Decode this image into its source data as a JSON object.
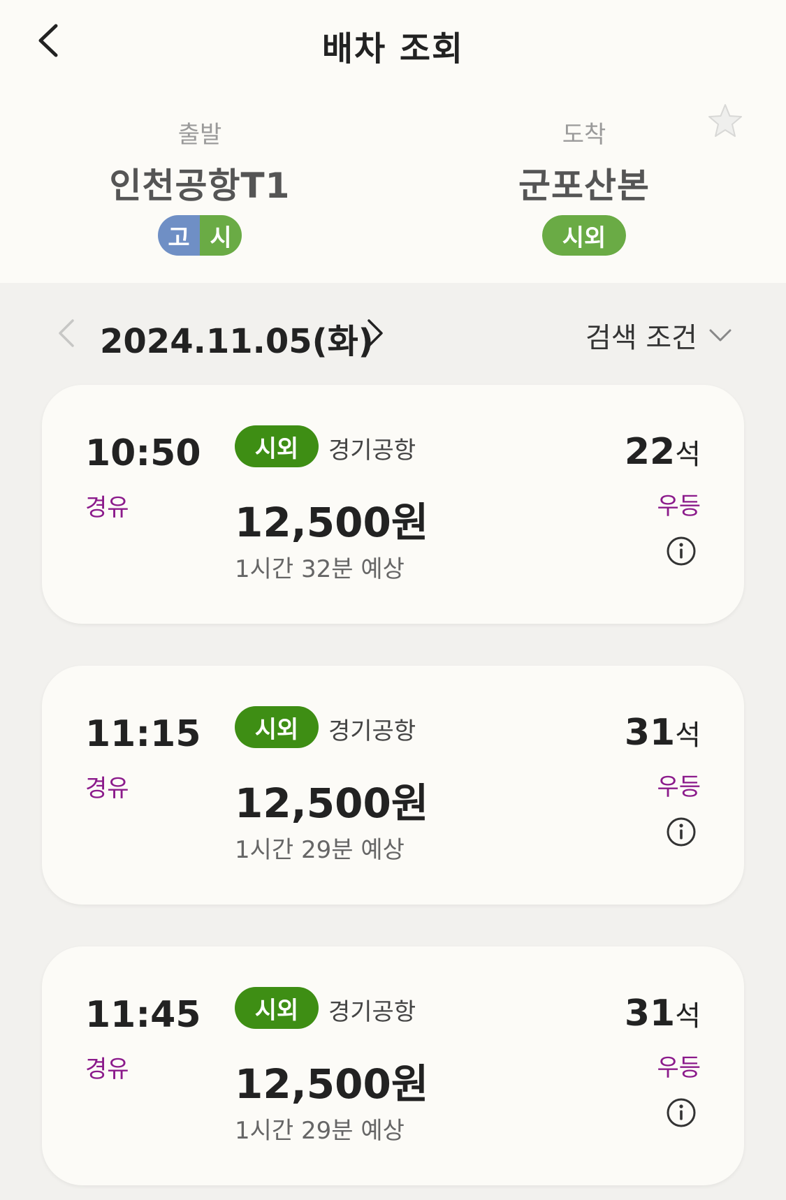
{
  "header": {
    "title": "배차 조회"
  },
  "route": {
    "departure": {
      "caption": "출발",
      "name": "인천공항T1",
      "badges": [
        "고",
        "시"
      ]
    },
    "arrival": {
      "caption": "도착",
      "name": "군포산본",
      "badges": [
        "시외"
      ]
    }
  },
  "date_bar": {
    "date": "2024.11.05(화)",
    "filter_label": "검색 조건"
  },
  "buses": [
    {
      "time": "10:50",
      "via": "경유",
      "type": "시외",
      "company": "경기공항",
      "price": "12,500원",
      "duration": "1시간 32분 예상",
      "seats": "22",
      "seats_unit": "석",
      "grade": "우등"
    },
    {
      "time": "11:15",
      "via": "경유",
      "type": "시외",
      "company": "경기공항",
      "price": "12,500원",
      "duration": "1시간 29분 예상",
      "seats": "31",
      "seats_unit": "석",
      "grade": "우등"
    },
    {
      "time": "11:45",
      "via": "경유",
      "type": "시외",
      "company": "경기공항",
      "price": "12,500원",
      "duration": "1시간 29분 예상",
      "seats": "31",
      "seats_unit": "석",
      "grade": "우등"
    }
  ],
  "colors": {
    "accent_green": "#3e8e14",
    "badge_blue": "#6f8fc5",
    "badge_green": "#6aab45",
    "via_purple": "#8b1a8b"
  },
  "icons": [
    "back-arrow-icon",
    "star-icon",
    "chevron-left-icon",
    "chevron-right-icon",
    "chevron-down-icon",
    "info-icon"
  ]
}
